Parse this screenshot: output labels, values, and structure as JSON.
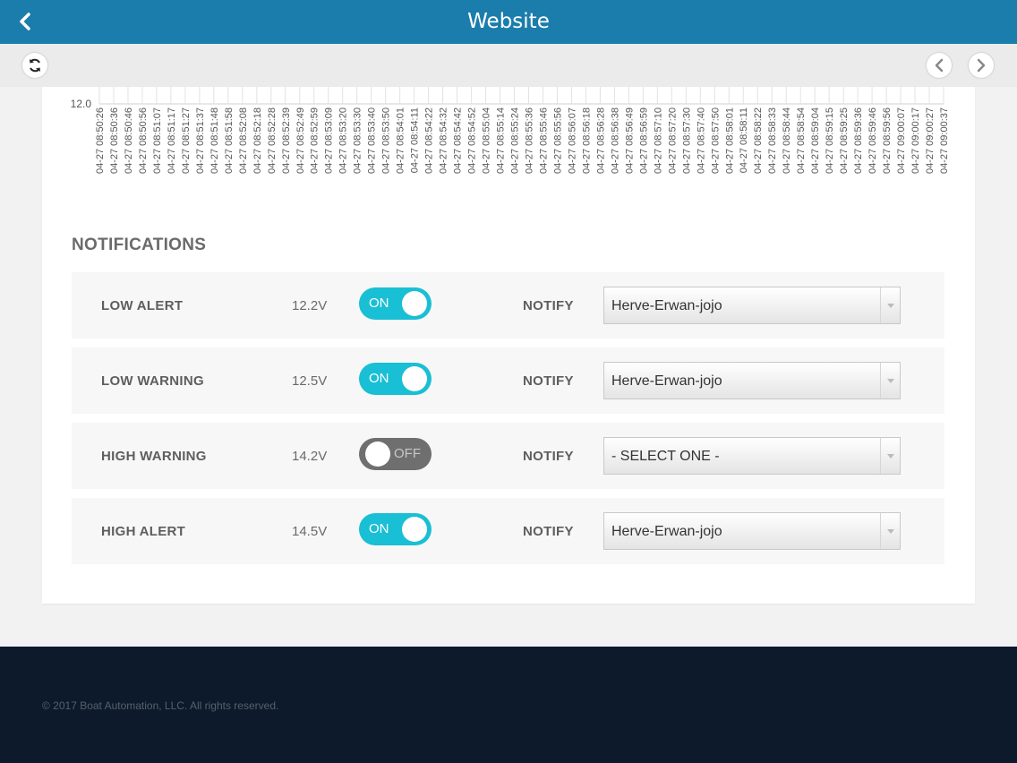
{
  "app": {
    "title": "Website"
  },
  "colors": {
    "header": "#1b7dab",
    "toggle_on": "#19bfd4",
    "toggle_off": "#6f6f6f",
    "footer": "#0c1a2b"
  },
  "icons": {
    "back": "chevron-left-icon",
    "refresh": "refresh-icon",
    "prev": "chevron-left-icon",
    "next": "chevron-right-icon",
    "dropdown": "caret-down-icon"
  },
  "chart_data": {
    "type": "line",
    "y_ticks": [
      "12.0"
    ],
    "x": [
      "04-27 08:50:26",
      "04-27 08:50:36",
      "04-27 08:50:46",
      "04-27 08:50:56",
      "04-27 08:51:07",
      "04-27 08:51:17",
      "04-27 08:51:27",
      "04-27 08:51:37",
      "04-27 08:51:48",
      "04-27 08:51:58",
      "04-27 08:52:08",
      "04-27 08:52:18",
      "04-27 08:52:28",
      "04-27 08:52:39",
      "04-27 08:52:49",
      "04-27 08:52:59",
      "04-27 08:53:09",
      "04-27 08:53:20",
      "04-27 08:53:30",
      "04-27 08:53:40",
      "04-27 08:53:50",
      "04-27 08:54:01",
      "04-27 08:54:11",
      "04-27 08:54:22",
      "04-27 08:54:32",
      "04-27 08:54:42",
      "04-27 08:54:52",
      "04-27 08:55:04",
      "04-27 08:55:14",
      "04-27 08:55:24",
      "04-27 08:55:36",
      "04-27 08:55:46",
      "04-27 08:55:56",
      "04-27 08:56:07",
      "04-27 08:56:18",
      "04-27 08:56:28",
      "04-27 08:56:38",
      "04-27 08:56:49",
      "04-27 08:56:59",
      "04-27 08:57:10",
      "04-27 08:57:20",
      "04-27 08:57:30",
      "04-27 08:57:40",
      "04-27 08:57:50",
      "04-27 08:58:01",
      "04-27 08:58:11",
      "04-27 08:58:22",
      "04-27 08:58:33",
      "04-27 08:58:44",
      "04-27 08:58:54",
      "04-27 08:59:04",
      "04-27 08:59:15",
      "04-27 08:59:25",
      "04-27 08:59:36",
      "04-27 08:59:46",
      "04-27 08:59:56",
      "04-27 09:00:07",
      "04-27 09:00:17",
      "04-27 09:00:27",
      "04-27 09:00:37"
    ],
    "grid": true
  },
  "notifications": {
    "title": "NOTIFICATIONS",
    "rows": [
      {
        "label": "LOW ALERT",
        "voltage": "12.2V",
        "toggle": "ON",
        "state": "on",
        "notify_label": "NOTIFY",
        "selected": "Herve-Erwan-jojo"
      },
      {
        "label": "LOW WARNING",
        "voltage": "12.5V",
        "toggle": "ON",
        "state": "on",
        "notify_label": "NOTIFY",
        "selected": "Herve-Erwan-jojo"
      },
      {
        "label": "HIGH WARNING",
        "voltage": "14.2V",
        "toggle": "OFF",
        "state": "off",
        "notify_label": "NOTIFY",
        "selected": "- SELECT ONE -"
      },
      {
        "label": "HIGH ALERT",
        "voltage": "14.5V",
        "toggle": "ON",
        "state": "on",
        "notify_label": "NOTIFY",
        "selected": "Herve-Erwan-jojo"
      }
    ]
  },
  "footer": {
    "copyright": "© 2017 Boat Automation, LLC. All rights reserved."
  }
}
